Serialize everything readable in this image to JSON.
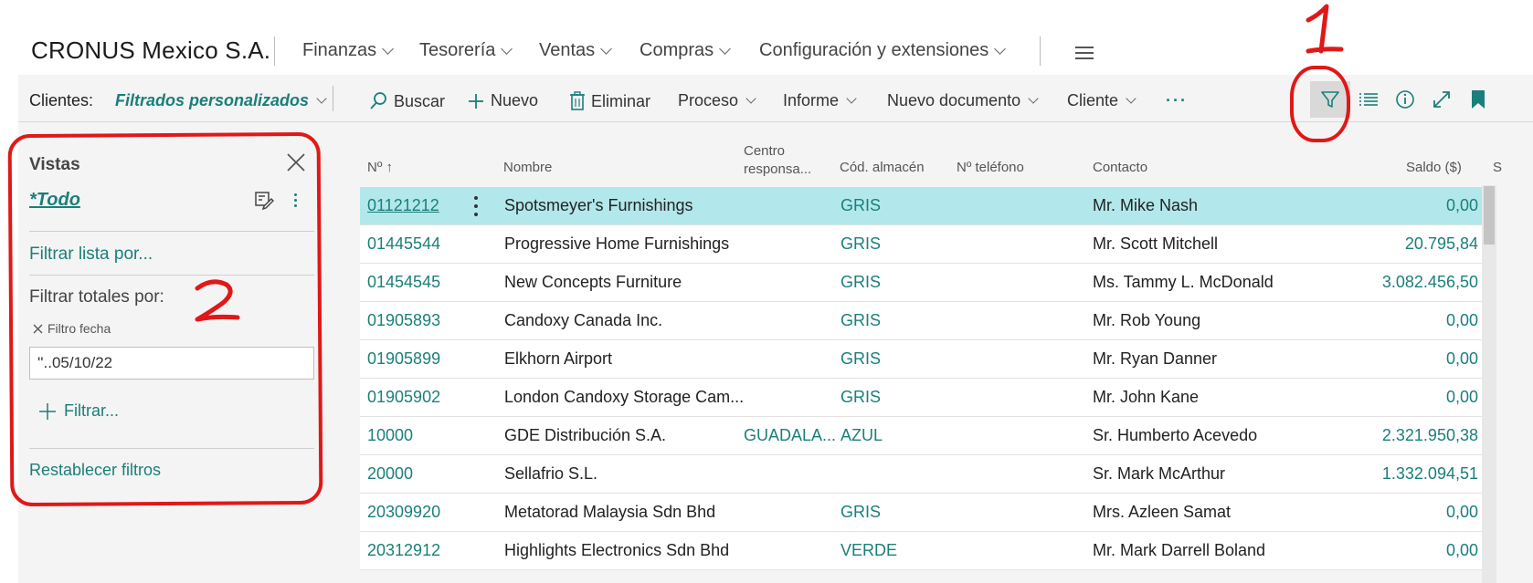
{
  "app": {
    "company": "CRONUS Mexico S.A.",
    "nav": [
      "Finanzas",
      "Tesorería",
      "Ventas",
      "Compras",
      "Configuración y extensiones"
    ]
  },
  "actionbar": {
    "label": "Clientes:",
    "filter_name": "Filtrados personalizados",
    "search": "Buscar",
    "new": "Nuevo",
    "delete": "Eliminar",
    "process": "Proceso",
    "report": "Informe",
    "new_document": "Nuevo documento",
    "customer": "Cliente",
    "more": "···",
    "icons": [
      "filter-icon",
      "list-icon",
      "info-icon",
      "expand-icon",
      "bookmark-icon"
    ]
  },
  "pane": {
    "title": "Vistas",
    "view": "*Todo",
    "filter_list": "Filtrar lista por...",
    "filter_totals": "Filtrar totales por:",
    "chip": "Filtro fecha",
    "date_value": "''..05/10/22",
    "add_filter": "Filtrar...",
    "reset": "Restablecer filtros"
  },
  "annotations": {
    "one": "1",
    "two": "2",
    "color": "#e01818"
  },
  "table": {
    "headers": {
      "no": "Nº",
      "name": "Nombre",
      "center_1": "Centro",
      "center_2": "responsa...",
      "warehouse": "Cód. almacén",
      "phone": "Nº teléfono",
      "contact": "Contacto",
      "balance": "Saldo ($)",
      "extra": "S"
    },
    "rows": [
      {
        "no": "01121212",
        "name": "Spotsmeyer's Furnishings",
        "center": "",
        "warehouse": "GRIS",
        "contact": "Mr. Mike Nash",
        "balance": "0,00"
      },
      {
        "no": "01445544",
        "name": "Progressive Home Furnishings",
        "center": "",
        "warehouse": "GRIS",
        "contact": "Mr. Scott Mitchell",
        "balance": "20.795,84"
      },
      {
        "no": "01454545",
        "name": "New Concepts Furniture",
        "center": "",
        "warehouse": "GRIS",
        "contact": "Ms. Tammy L. McDonald",
        "balance": "3.082.456,50"
      },
      {
        "no": "01905893",
        "name": "Candoxy Canada Inc.",
        "center": "",
        "warehouse": "GRIS",
        "contact": "Mr. Rob Young",
        "balance": "0,00"
      },
      {
        "no": "01905899",
        "name": "Elkhorn Airport",
        "center": "",
        "warehouse": "GRIS",
        "contact": "Mr. Ryan Danner",
        "balance": "0,00"
      },
      {
        "no": "01905902",
        "name": "London Candoxy Storage Cam...",
        "center": "",
        "warehouse": "GRIS",
        "contact": "Mr. John Kane",
        "balance": "0,00"
      },
      {
        "no": "10000",
        "name": "GDE Distribución S.A.",
        "center": "GUADALA...",
        "warehouse": "AZUL",
        "contact": "Sr. Humberto Acevedo",
        "balance": "2.321.950,38"
      },
      {
        "no": "20000",
        "name": "Sellafrio S.L.",
        "center": "",
        "warehouse": "",
        "contact": "Sr. Mark McArthur",
        "balance": "1.332.094,51"
      },
      {
        "no": "20309920",
        "name": "Metatorad Malaysia Sdn Bhd",
        "center": "",
        "warehouse": "GRIS",
        "contact": "Mrs. Azleen Samat",
        "balance": "0,00"
      },
      {
        "no": "20312912",
        "name": "Highlights Electronics Sdn Bhd",
        "center": "",
        "warehouse": "VERDE",
        "contact": "Mr. Mark Darrell Boland",
        "balance": "0,00"
      }
    ]
  }
}
